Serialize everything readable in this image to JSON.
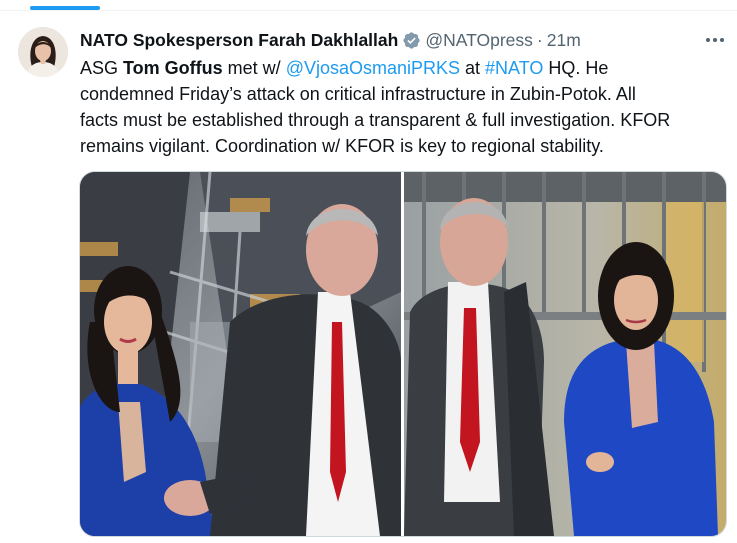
{
  "tweet": {
    "author": {
      "name": "NATO Spokesperson Farah Dakhlallah",
      "handle": "@NATOpress",
      "separator": "·",
      "time": "21m",
      "avatar_icon": "portrait-avatar",
      "verified_icon": "verified-badge-icon"
    },
    "text": {
      "l1_a": "ASG ",
      "l1_name": "Tom Goffus",
      "l1_b": " met w/ ",
      "l1_mention": "@VjosaOsmaniPRKS",
      "l1_c": " at ",
      "l1_hashtag": "#NATO",
      "l1_d": " HQ. He",
      "l2": "condemned Friday’s attack on critical infrastructure in Zubin-Potok. All",
      "l3": "facts must be established through a transparent & full investigation. KFOR",
      "l4": "remains vigilant. Coordination w/ KFOR is key to regional stability."
    },
    "media": {
      "photo_count": 2
    },
    "colors": {
      "accent": "#1d9bf0",
      "text": "#0f1419",
      "muted": "#536471",
      "verified": "#829aab"
    }
  }
}
